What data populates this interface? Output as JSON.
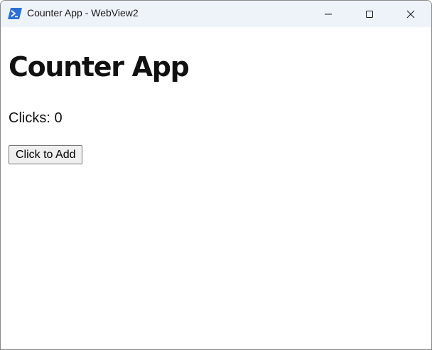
{
  "window": {
    "title": "Counter App - WebView2",
    "app_icon": "powershell-icon",
    "controls": {
      "minimize": "minimize-icon",
      "maximize": "maximize-icon",
      "close": "close-icon"
    }
  },
  "page": {
    "heading": "Counter App",
    "clicks_label": "Clicks:",
    "clicks_value": "0",
    "button_label": "Click to Add"
  },
  "colors": {
    "titlebar_bg": "#eef3f9",
    "icon_blue": "#2b6fd6",
    "text": "#111111"
  }
}
